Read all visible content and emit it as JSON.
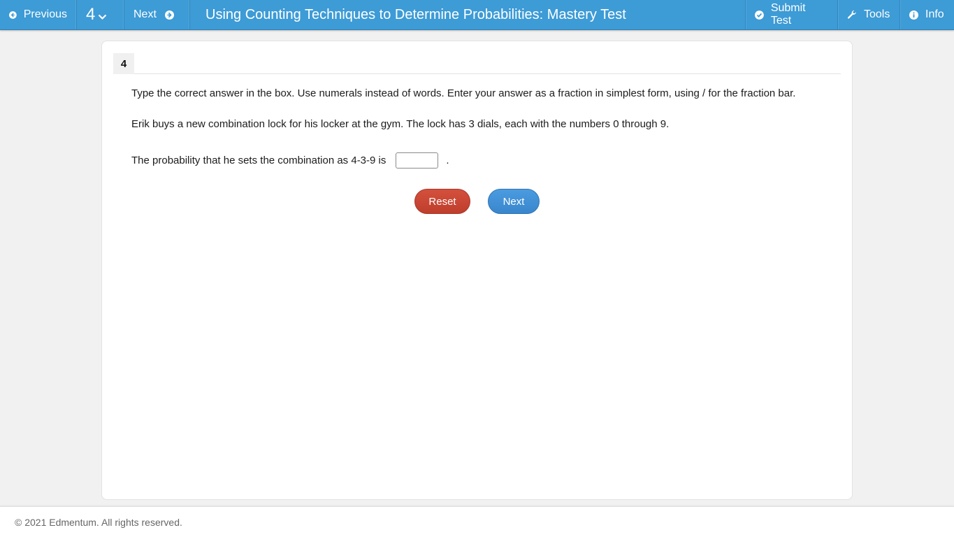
{
  "topbar": {
    "previous_label": "Previous",
    "question_number": "4",
    "next_label": "Next",
    "title": "Using Counting Techniques to Determine Probabilities: Mastery Test",
    "submit_label": "Submit Test",
    "tools_label": "Tools",
    "info_label": "Info"
  },
  "question": {
    "number": "4",
    "instructions": "Type the correct answer in the box. Use numerals instead of words. Enter your answer as a fraction in simplest form, using / for the fraction bar.",
    "prompt": "Erik buys a new combination lock for his locker at the gym. The lock has 3 dials, each with the numbers 0 through 9.",
    "statement_before": "The probability that he sets the combination as 4-3-9 is",
    "statement_after": ".",
    "answer_value": ""
  },
  "buttons": {
    "reset_label": "Reset",
    "next_label": "Next"
  },
  "footer": {
    "copyright": "© 2021 Edmentum. All rights reserved."
  },
  "colors": {
    "topbar": "#3d9bd6",
    "reset": "#c9472f",
    "next": "#4291d6"
  }
}
